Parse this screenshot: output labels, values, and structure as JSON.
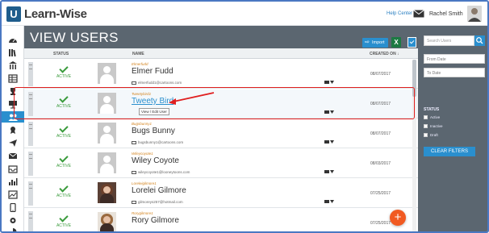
{
  "app": {
    "name": "Learn-Wise",
    "logo_letter": "U"
  },
  "header": {
    "help_label": "Help Center",
    "user_name": "Rachel Smith"
  },
  "page": {
    "title": "VIEW USERS",
    "import_label": "Import",
    "excel_label": "X"
  },
  "table": {
    "columns": {
      "status": "STATUS",
      "name": "NAME",
      "created": "CREATED ON ↓"
    },
    "rows": [
      {
        "username": "Elmerfudd",
        "fullname": "Elmer Fudd",
        "email": "elmerfudd1@cartoons.com",
        "status": "ACTIVE",
        "created": "08/07/2017"
      },
      {
        "username": "Tweetybird1",
        "fullname": "Tweety Bird",
        "email": "",
        "status": "ACTIVE",
        "created": "08/07/2017",
        "tooltip": "View / Edit User"
      },
      {
        "username": "Bugsbunny1",
        "fullname": "Bugs Bunny",
        "email": "bugsbunny1@cartoons.com",
        "status": "ACTIVE",
        "created": "08/07/2017"
      },
      {
        "username": "Wileycoyote1",
        "fullname": "Wiley Coyote",
        "email": "wileycoyote1@looneytoons.com",
        "status": "ACTIVE",
        "created": "08/03/2017"
      },
      {
        "username": "Loreleigilmore1",
        "fullname": "Lorelei Gilmore",
        "email": "gilmoreys257@hotmail.com",
        "status": "ACTIVE",
        "created": "07/25/2017"
      },
      {
        "username": "Rorygilmore1",
        "fullname": "Rory Gilmore",
        "email": "",
        "status": "ACTIVE",
        "created": "07/25/2017"
      }
    ]
  },
  "filters": {
    "search_placeholder": "Search Users",
    "from_date": "From Date",
    "to_date": "To Date",
    "status_heading": "STATUS",
    "options": [
      "Active",
      "Inactive",
      "Draft"
    ],
    "clear_label": "CLEAR FILTERS"
  },
  "fab_label": "+",
  "icons": {
    "sidebar": [
      "dashboard-icon",
      "library-icon",
      "building-icon",
      "table-icon",
      "trophy-icon",
      "presentation-icon",
      "users-icon",
      "badges-icon",
      "paper-plane-icon",
      "mail-icon",
      "inbox-icon",
      "reports-icon",
      "chart-icon",
      "tablet-icon",
      "settings-icon",
      "pie-chart-icon"
    ]
  },
  "colors": {
    "accent": "#2a8fce",
    "panel": "#5b6670",
    "status_active": "#3a9b3c",
    "username": "#d4841f",
    "fab": "#f15a22",
    "annotation": "#e02020"
  }
}
